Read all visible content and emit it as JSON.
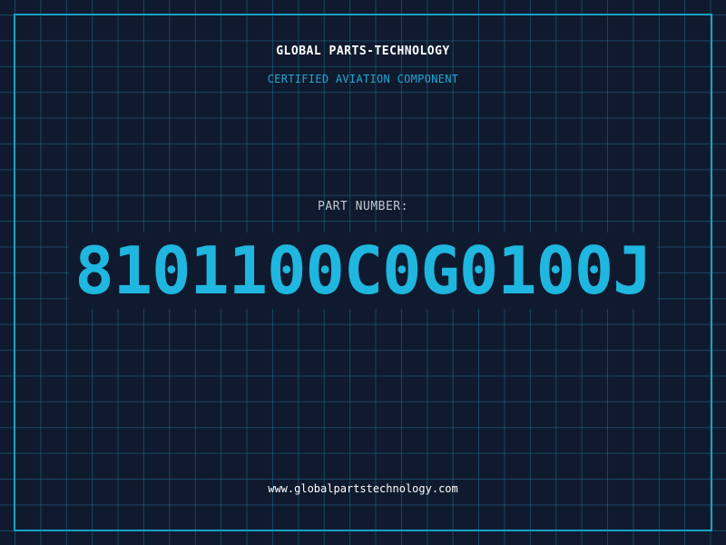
{
  "header": {
    "company": "GLOBAL PARTS-TECHNOLOGY",
    "subtitle": "CERTIFIED AVIATION COMPONENT"
  },
  "part": {
    "label": "PART NUMBER:",
    "number": "8101100C0G0100J"
  },
  "footer": {
    "website": "www.globalpartstechnology.com"
  },
  "colors": {
    "background": "#101a2e",
    "grid": "#1a6e8c",
    "accent": "#1fb6df",
    "text": "#ffffff"
  }
}
